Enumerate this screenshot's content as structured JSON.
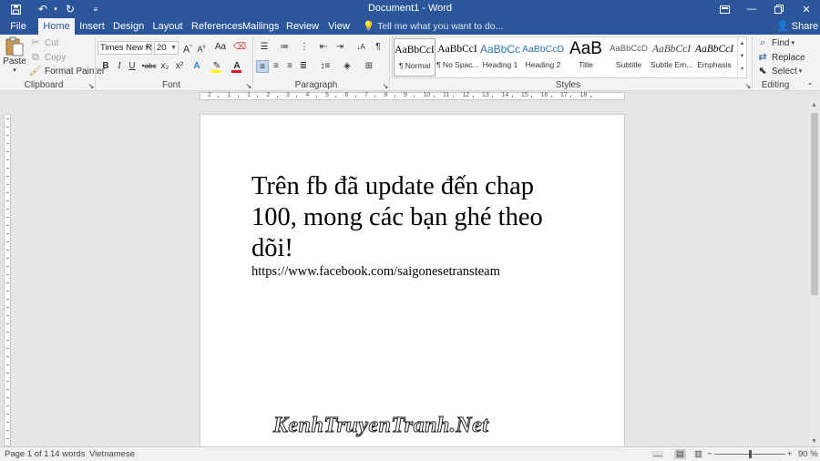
{
  "window": {
    "doc_title": "Document1 - Word",
    "share_label": "Share",
    "ribbon_options_icon": "ribbon-display-icon",
    "min_icon": "minimize-icon",
    "max_icon": "restore-icon",
    "close_icon": "close-icon"
  },
  "quick_access": {
    "save_icon": "save-icon",
    "undo_icon": "undo-icon",
    "redo_icon": "redo-icon",
    "customize_icon": "customize-icon"
  },
  "tabs": [
    "File",
    "Home",
    "Insert",
    "Design",
    "Layout",
    "References",
    "Mailings",
    "Review",
    "View"
  ],
  "active_tab": "Home",
  "tell_me": "Tell me what you want to do...",
  "clipboard": {
    "paste": "Paste",
    "cut": "Cut",
    "copy": "Copy",
    "format_painter": "Format Painter",
    "label": "Clipboard"
  },
  "font": {
    "family": "Times New Ro",
    "size": "20",
    "label": "Font",
    "bold": "B",
    "italic": "I",
    "underline": "U",
    "strike": "abc",
    "subscript": "x₂",
    "superscript": "x²",
    "grow": "A",
    "shrink": "A",
    "case": "Aa",
    "text_effects": "A",
    "font_color": "A",
    "highlight_color": "#ffff00",
    "font_color_value": "#e81123"
  },
  "paragraph": {
    "label": "Paragraph",
    "show_marks": "¶",
    "sort": "↓A"
  },
  "styles": {
    "label": "Styles",
    "items": [
      {
        "preview": "AaBbCcI",
        "name": "¶ Normal"
      },
      {
        "preview": "AaBbCcI",
        "name": "¶ No Spac..."
      },
      {
        "preview": "AaBbCc",
        "name": "Heading 1"
      },
      {
        "preview": "AaBbCcD",
        "name": "Heading 2"
      },
      {
        "preview": "AaB",
        "name": "Title"
      },
      {
        "preview": "AaBbCcD",
        "name": "Subtitle"
      },
      {
        "preview": "AaBbCcI",
        "name": "Subtle Em..."
      },
      {
        "preview": "AaBbCcI",
        "name": "Emphasis"
      }
    ]
  },
  "editing": {
    "label": "Editing",
    "find": "Find",
    "replace": "Replace",
    "select": "Select"
  },
  "ruler": {
    "numbers": [
      "2",
      "1",
      "1",
      "2",
      "3",
      "4",
      "5",
      "6",
      "7",
      "8",
      "9",
      "10",
      "11",
      "12",
      "13",
      "14",
      "15",
      "16",
      "17",
      "18"
    ]
  },
  "document": {
    "heading": "Trên fb đã update đến chap 100, mong các bạn ghé theo dõi!",
    "link": "https://www.facebook.com/saigonesetransteam"
  },
  "watermark": "KenhTruyenTranh.Net",
  "status": {
    "page": "Page 1 of 1",
    "words": "14 words",
    "language": "Vietnamese",
    "zoom": "90 %",
    "zoom_level": 0.9
  },
  "colors": {
    "brand": "#2b579a",
    "ribbon": "#f3f3f3",
    "canvas": "#e5e5e5"
  }
}
